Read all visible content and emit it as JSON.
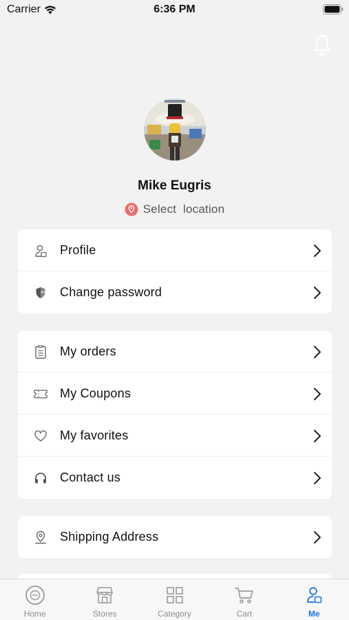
{
  "status_bar": {
    "carrier": "Carrier",
    "time": "6:36 PM"
  },
  "profile": {
    "name": "Mike Eugris",
    "location_prompt": "Select  location"
  },
  "groups": [
    [
      {
        "icon": "profile-icon",
        "label": "Profile"
      },
      {
        "icon": "shield-icon",
        "label": "Change password"
      }
    ],
    [
      {
        "icon": "clipboard-icon",
        "label": "My orders"
      },
      {
        "icon": "coupon-icon",
        "label": "My Coupons"
      },
      {
        "icon": "heart-icon",
        "label": "My favorites"
      },
      {
        "icon": "headset-icon",
        "label": "Contact us"
      }
    ],
    [
      {
        "icon": "location-pin-icon",
        "label": "Shipping Address"
      }
    ]
  ],
  "tabs": [
    {
      "icon": "home-icon",
      "label": "Home",
      "active": false
    },
    {
      "icon": "store-icon",
      "label": "Stores",
      "active": false
    },
    {
      "icon": "category-icon",
      "label": "Category",
      "active": false
    },
    {
      "icon": "cart-icon",
      "label": "Cart",
      "active": false
    },
    {
      "icon": "me-icon",
      "label": "Me",
      "active": true
    }
  ],
  "colors": {
    "accent": "#1a73e8",
    "location_pin": "#f06a6a",
    "background": "#f2f2f2",
    "card": "#ffffff",
    "tab_inactive": "#8e8e93"
  }
}
